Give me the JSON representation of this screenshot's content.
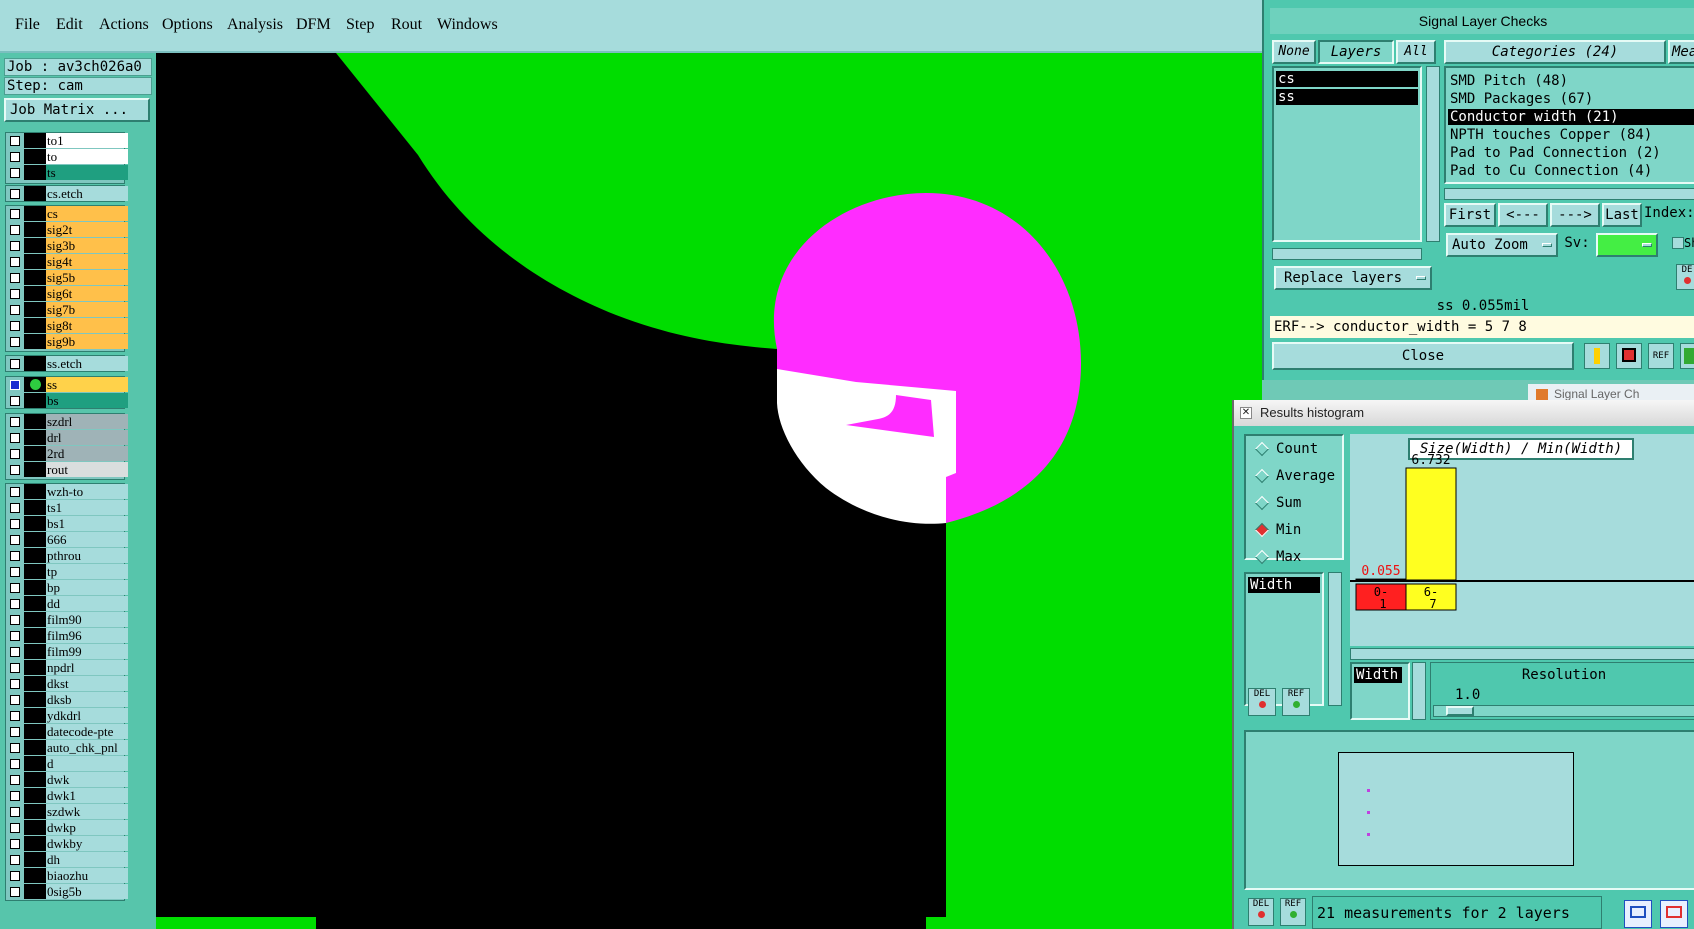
{
  "menu": [
    "File",
    "Edit",
    "Actions",
    "Options",
    "Analysis",
    "DFM",
    "Step",
    "Rout",
    "Windows"
  ],
  "job": {
    "job_line": "Job : av3ch026a0",
    "step_line": "Step: cam",
    "matrix_button": "Job Matrix ..."
  },
  "layers": [
    {
      "name": "to1",
      "color": "#ffffff"
    },
    {
      "name": "to",
      "color": "#ffffff"
    },
    {
      "name": "ts",
      "color": "#1f9f80"
    },
    {
      "name": "cs.etch",
      "color": "#a6dcdc"
    },
    {
      "name": "cs",
      "color": "#ffc04a"
    },
    {
      "name": "sig2t",
      "color": "#ffc04a"
    },
    {
      "name": "sig3b",
      "color": "#ffc04a"
    },
    {
      "name": "sig4t",
      "color": "#ffc04a"
    },
    {
      "name": "sig5b",
      "color": "#ffc04a"
    },
    {
      "name": "sig6t",
      "color": "#ffc04a"
    },
    {
      "name": "sig7b",
      "color": "#ffc04a"
    },
    {
      "name": "sig8t",
      "color": "#ffc04a"
    },
    {
      "name": "sig9b",
      "color": "#ffc04a"
    },
    {
      "name": "ss.etch",
      "color": "#a6dcdc"
    },
    {
      "name": "ss",
      "color": "#ffd24a"
    },
    {
      "name": "bs",
      "color": "#1f9f80"
    },
    {
      "name": "szdrl",
      "color": "#9fb3b7"
    },
    {
      "name": "drl",
      "color": "#9fb3b7"
    },
    {
      "name": "2rd",
      "color": "#9fb3b7"
    },
    {
      "name": "rout",
      "color": "#d9dede"
    },
    {
      "name": "wzh-to",
      "color": "#a6dcdc"
    },
    {
      "name": "ts1",
      "color": "#a6dcdc"
    },
    {
      "name": "bs1",
      "color": "#a6dcdc"
    },
    {
      "name": "666",
      "color": "#a6dcdc"
    },
    {
      "name": "pthrou",
      "color": "#a6dcdc"
    },
    {
      "name": "tp",
      "color": "#a6dcdc"
    },
    {
      "name": "bp",
      "color": "#a6dcdc"
    },
    {
      "name": "dd",
      "color": "#a6dcdc"
    },
    {
      "name": "film90",
      "color": "#a6dcdc"
    },
    {
      "name": "film96",
      "color": "#a6dcdc"
    },
    {
      "name": "film99",
      "color": "#a6dcdc"
    },
    {
      "name": "npdrl",
      "color": "#a6dcdc"
    },
    {
      "name": "dkst",
      "color": "#a6dcdc"
    },
    {
      "name": "dksb",
      "color": "#a6dcdc"
    },
    {
      "name": "ydkdrl",
      "color": "#a6dcdc"
    },
    {
      "name": "datecode-pte",
      "color": "#a6dcdc"
    },
    {
      "name": "auto_chk_pnl",
      "color": "#a6dcdc"
    },
    {
      "name": "d",
      "color": "#a6dcdc"
    },
    {
      "name": "dwk",
      "color": "#a6dcdc"
    },
    {
      "name": "dwk1",
      "color": "#a6dcdc"
    },
    {
      "name": "szdwk",
      "color": "#a6dcdc"
    },
    {
      "name": "dwkp",
      "color": "#a6dcdc"
    },
    {
      "name": "dwkby",
      "color": "#a6dcdc"
    },
    {
      "name": "dh",
      "color": "#a6dcdc"
    },
    {
      "name": "biaozhu",
      "color": "#a6dcdc"
    },
    {
      "name": "0sig5b",
      "color": "#a6dcdc"
    }
  ],
  "signal_checks": {
    "title": "Signal Layer Checks",
    "none_btn": "None",
    "layers_btn": "Layers",
    "all_btn": "All",
    "categories_btn": "Categories (24)",
    "meas_btn": "Mea",
    "layer_list": [
      "cs",
      "ss"
    ],
    "categories": [
      "SMD Pitch (48)",
      "SMD Packages (67)",
      "Conductor width (21)",
      "NPTH touches Copper (84)",
      "Pad to Pad Connection (2)",
      "Pad to Cu Connection (4)"
    ],
    "nav": {
      "first": "First",
      "prev": "<---",
      "next": "--->",
      "last": "Last",
      "index": "Index:"
    },
    "zoom": "Auto Zoom",
    "sv_label": "Sv:",
    "sh_label": "Sh",
    "replace": "Replace layers",
    "status": "ss 0.055mil",
    "erf": "ERF--> conductor_width = 5 7 8",
    "close": "Close",
    "del_label": "DE",
    "ref_label": "REF"
  },
  "histogram": {
    "title": "Results histogram",
    "radios": [
      {
        "label": "Count",
        "on": false
      },
      {
        "label": "Average",
        "on": false
      },
      {
        "label": "Sum",
        "on": false
      },
      {
        "label": "Min",
        "on": true
      },
      {
        "label": "Max",
        "on": false
      }
    ],
    "field": "Width",
    "field2": "Width",
    "chart_title": "Size(Width) / Min(Width)",
    "resolution_label": "Resolution",
    "resolution_value": "1.0",
    "del": "DEL",
    "ref": "REF",
    "status": "21 measurements for 2 layers"
  },
  "behind_window_title": "Signal Layer Ch",
  "chart_data": {
    "type": "bar",
    "title": "Size(Width) / Min(Width)",
    "categories": [
      "0-1",
      "6-7"
    ],
    "category_lines": [
      [
        "0-",
        "1"
      ],
      [
        "6-",
        "7"
      ]
    ],
    "values": [
      0.055,
      6.732
    ],
    "value_labels": [
      "0.055",
      "6.732"
    ],
    "colors": [
      "#ff2020",
      "#ffff20"
    ],
    "label_colors": [
      "#ee1111",
      "#000000"
    ],
    "ylim": [
      0,
      6.732
    ]
  }
}
